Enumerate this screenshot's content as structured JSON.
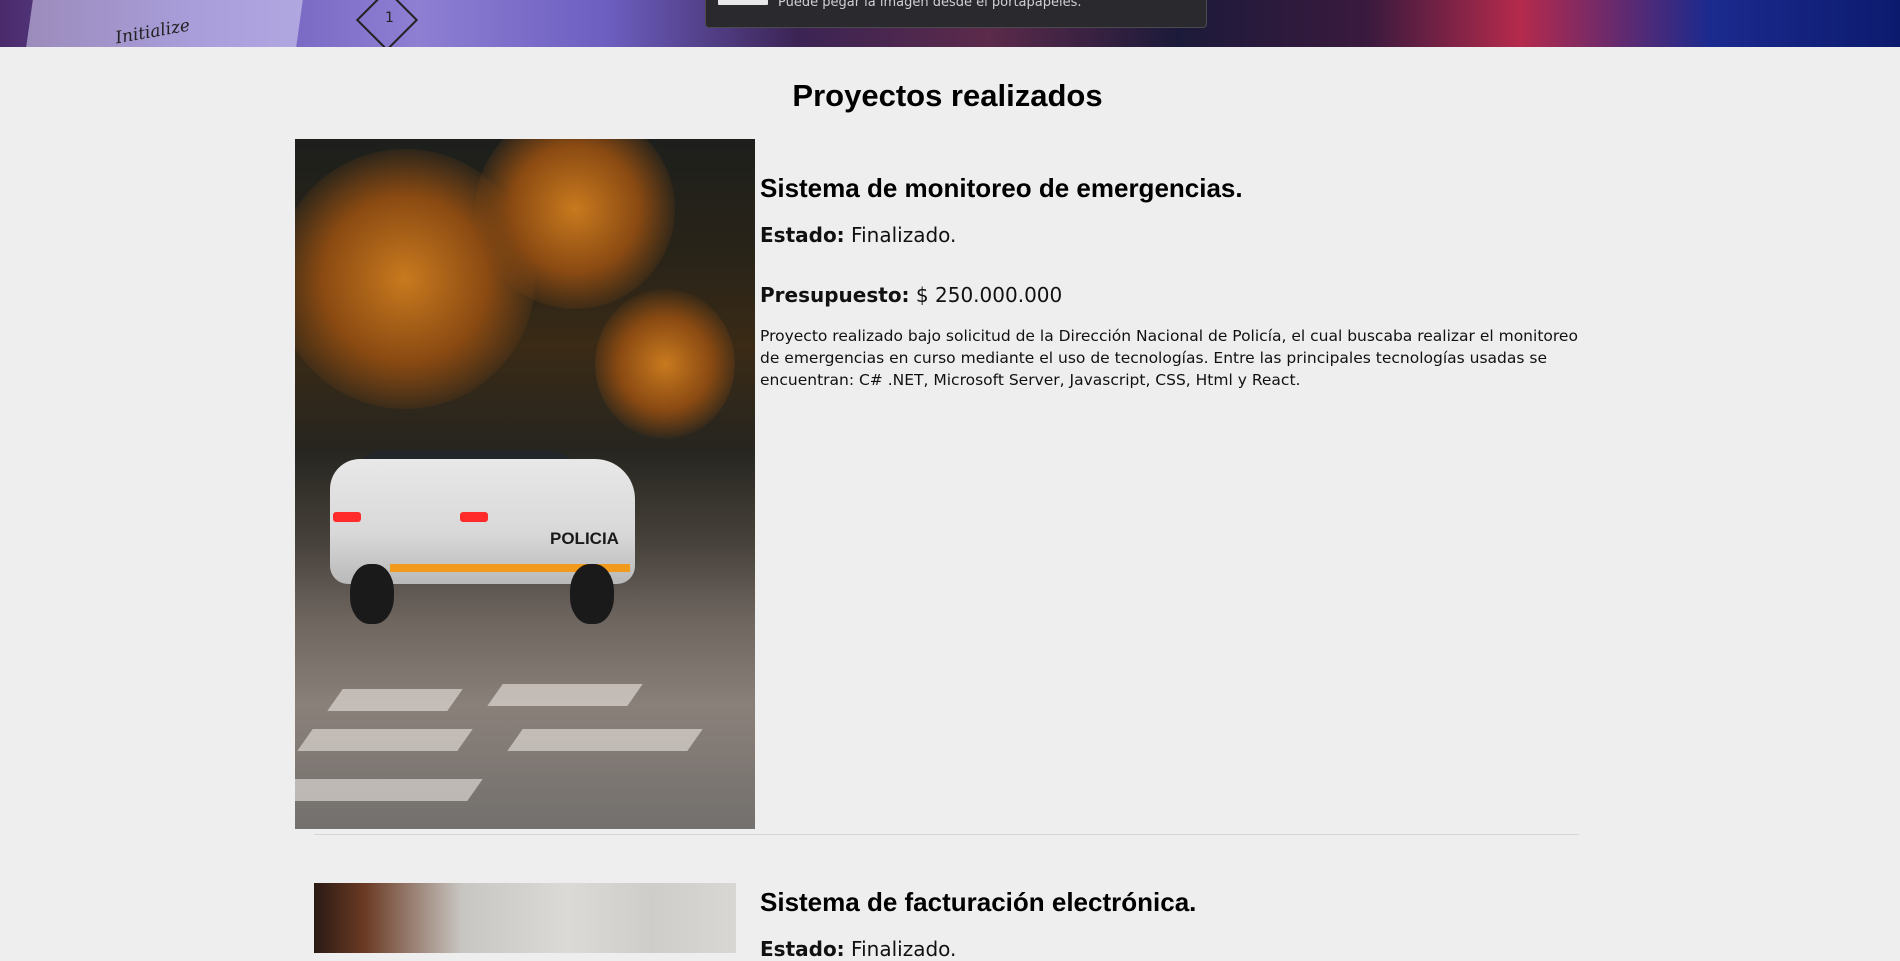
{
  "hero": {
    "paper_text": "Initialize",
    "diamond_label": "1"
  },
  "toast": {
    "message": "Puede pegar la imagen desde el portapapeles."
  },
  "page": {
    "title": "Proyectos realizados"
  },
  "projects": [
    {
      "title": "Sistema de monitoreo de emergencias.",
      "estado_label": "Estado:",
      "estado_value": "Finalizado.",
      "presupuesto_label": "Presupuesto:",
      "presupuesto_value": "$ 250.000.000",
      "description": "Proyecto realizado bajo solicitud de la Dirección Nacional de Policía, el cual buscaba realizar el monitoreo de emergencias en curso mediante el uso de tecnologías. Entre las principales tecnologías usadas se encuentran: C# .NET, Microsoft Server, Javascript, CSS, Html y React.",
      "image_text": "POLICIA"
    },
    {
      "title": "Sistema de facturación electrónica.",
      "estado_label": "Estado:",
      "estado_value": "Finalizado."
    }
  ],
  "colors": {
    "background": "#eeeeee",
    "text": "#111111",
    "divider": "#d6d6d6"
  }
}
